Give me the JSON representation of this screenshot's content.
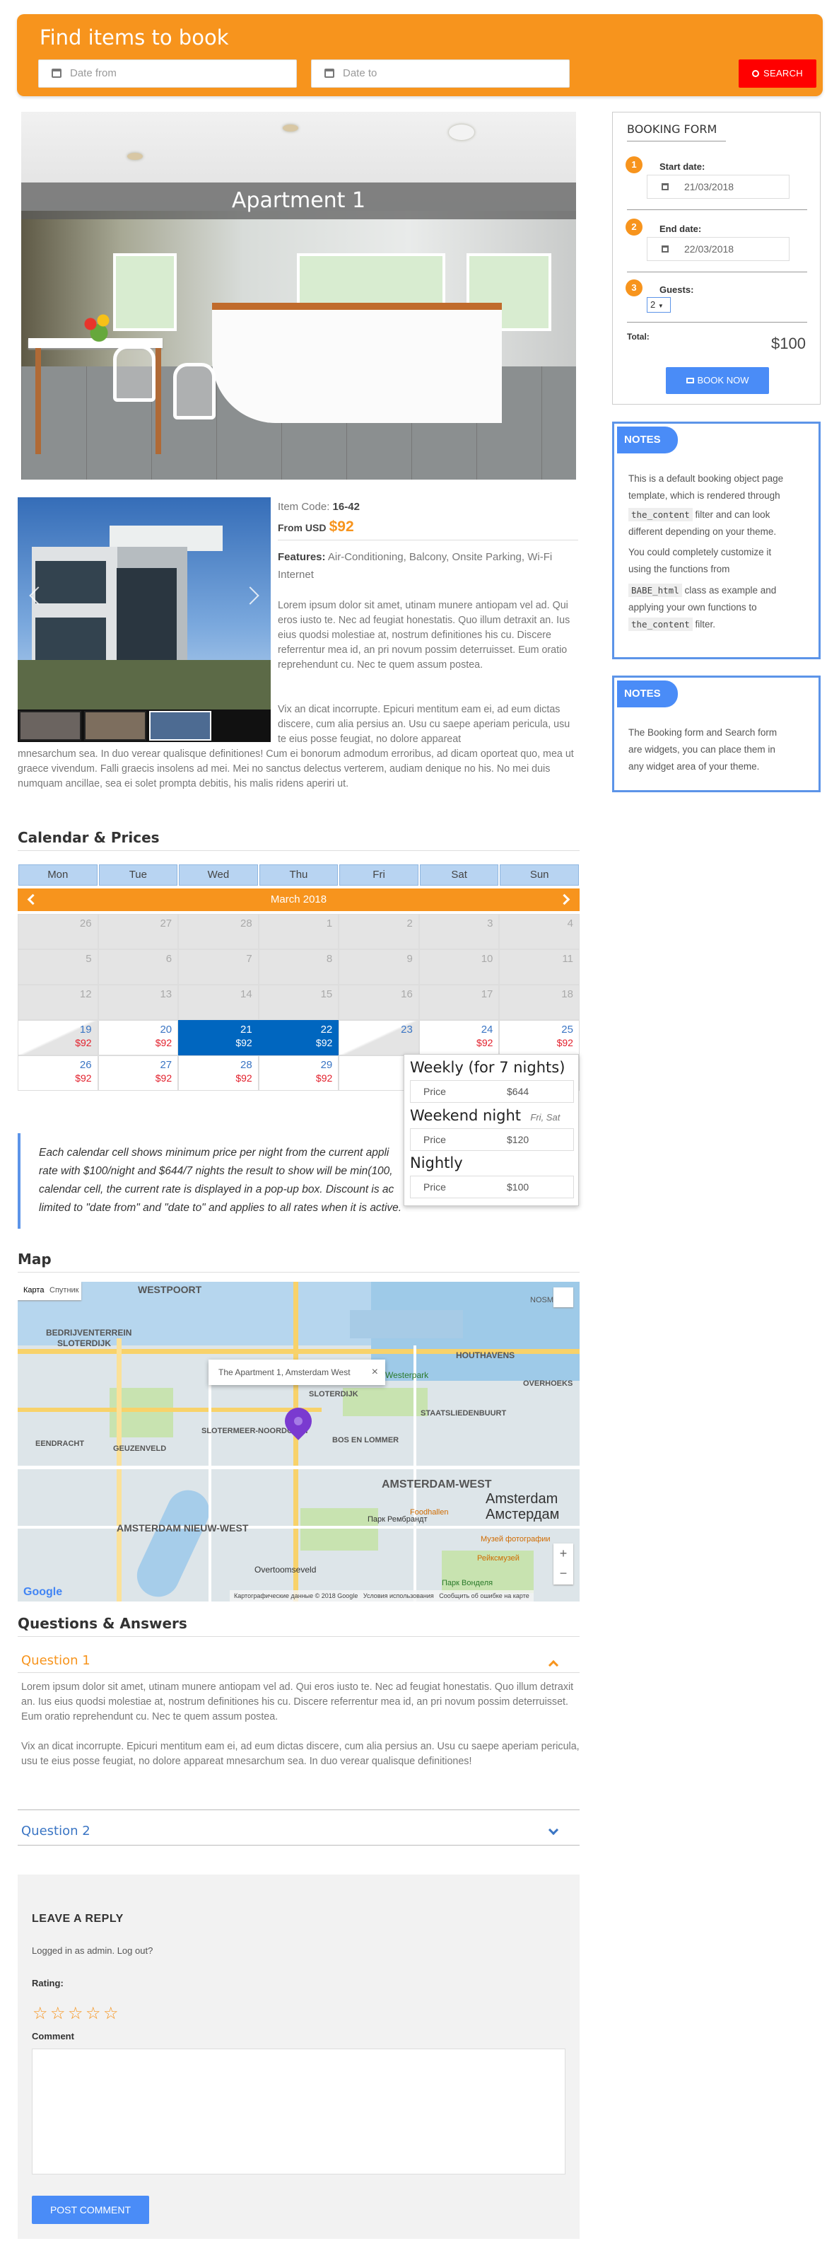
{
  "search": {
    "title": "Find items to book",
    "date_from_placeholder": "Date from",
    "date_to_placeholder": "Date to",
    "search_label": "SEARCH"
  },
  "hero": {
    "title": "Apartment 1"
  },
  "item": {
    "code_label": "Item Code:",
    "code": "16-42",
    "from_label": "From USD",
    "price": "$92",
    "features_label": "Features:",
    "features": "Air-Conditioning, Balcony, Onsite Parking, Wi-Fi Internet",
    "desc_p1": "Lorem ipsum dolor sit amet, utinam munere antiopam vel ad. Qui eros iusto te. Nec ad feugiat honestatis. Quo illum detraxit an. Ius eius quodsi molestiae at, nostrum definitiones his cu. Discere referrentur mea id, an pri novum possim deterruisset. Eum oratio reprehendunt cu. Nec te quem assum postea.",
    "desc_p2_line1": "Vix an dicat incorrupte. Epicuri mentitum eam ei, ad eum dictas discere, cum alia persius an. Usu cu saepe aperiam pericula, usu te eius posse feugiat, no dolore appareat",
    "desc_p2_rest": "mnesarchum sea. In duo verear qualisque definitiones! Cum ei bonorum admodum erroribus, ad dicam oporteat quo, mea ut graece vivendum. Falli graecis insolens ad mei. Mei no sanctus delectus verterem, audiam denique no his. No mei duis numquam ancillae, sea ei solet prompta debitis, his malis ridens aperiri ut."
  },
  "calendar": {
    "section_title": "Calendar & Prices",
    "days": [
      "Mon",
      "Tue",
      "Wed",
      "Thu",
      "Fri",
      "Sat",
      "Sun"
    ],
    "month": "March 2018",
    "weeks": [
      [
        {
          "d": "26",
          "s": "dim"
        },
        {
          "d": "27",
          "s": "dim"
        },
        {
          "d": "28",
          "s": "dim"
        },
        {
          "d": "1",
          "s": "dim"
        },
        {
          "d": "2",
          "s": "dim"
        },
        {
          "d": "3",
          "s": "dim"
        },
        {
          "d": "4",
          "s": "dim"
        }
      ],
      [
        {
          "d": "5",
          "s": "dim"
        },
        {
          "d": "6",
          "s": "dim"
        },
        {
          "d": "7",
          "s": "dim"
        },
        {
          "d": "8",
          "s": "dim"
        },
        {
          "d": "9",
          "s": "dim"
        },
        {
          "d": "10",
          "s": "dim"
        },
        {
          "d": "11",
          "s": "dim"
        }
      ],
      [
        {
          "d": "12",
          "s": "dim"
        },
        {
          "d": "13",
          "s": "dim"
        },
        {
          "d": "14",
          "s": "dim"
        },
        {
          "d": "15",
          "s": "dim"
        },
        {
          "d": "16",
          "s": "dim"
        },
        {
          "d": "17",
          "s": "dim"
        },
        {
          "d": "18",
          "s": "dim"
        }
      ],
      [
        {
          "d": "19",
          "s": "half",
          "p": "$92"
        },
        {
          "d": "20",
          "s": "act",
          "p": "$92"
        },
        {
          "d": "21",
          "s": "sel",
          "p": "$92"
        },
        {
          "d": "22",
          "s": "sel",
          "p": "$92"
        },
        {
          "d": "23",
          "s": "half"
        },
        {
          "d": "24",
          "s": "act",
          "p": "$92"
        },
        {
          "d": "25",
          "s": "act",
          "p": "$92"
        }
      ],
      [
        {
          "d": "26",
          "s": "act",
          "p": "$92"
        },
        {
          "d": "27",
          "s": "act",
          "p": "$92"
        },
        {
          "d": "28",
          "s": "act",
          "p": "$92"
        },
        {
          "d": "29",
          "s": "act",
          "p": "$92"
        },
        {
          "d": "",
          "s": "act"
        },
        {
          "d": "",
          "s": "act"
        },
        {
          "d": "",
          "s": "act"
        }
      ]
    ],
    "popup": {
      "weekly_title": "Weekly (for 7 nights)",
      "weekly_price_label": "Price",
      "weekly_price": "$644",
      "weekend_title": "Weekend night",
      "weekend_days": "Fri, Sat",
      "weekend_price_label": "Price",
      "weekend_price": "$120",
      "nightly_title": "Nightly",
      "nightly_price_label": "Price",
      "nightly_price": "$100"
    }
  },
  "quote": {
    "line1": "Each calendar cell shows minimum price per night from the current appli",
    "line2": "rate with $100/night and $644/7 nights the result to show will be min(100,",
    "line3": "calendar cell, the current rate is displayed in a pop-up box. Discount is ac",
    "line4": "limited to \"date from\" and \"date to\" and applies to all rates when it is active."
  },
  "map": {
    "section_title": "Map",
    "type_map": "Карта",
    "type_sat": "Спутник",
    "infowindow": "The Apartment 1, Amsterdam West",
    "labels": {
      "westpoort": "WESTPOORT",
      "bedrijventerrein": "BEDRIJVENTERREIN",
      "sloterdijk_top": "SLOTERDIJK",
      "houthavens": "HOUTHAVENS",
      "overhoeks": "OVERHOEKS",
      "sloterdijk": "SLOTERDIJK",
      "staatslieden": "STAATSLIEDENBUURT",
      "eendracht": "EENDRACHT",
      "geuzenveld": "GEUZENVELD",
      "slotermeer": "SLOTERMEER-NOORDOOST",
      "bos_en_lommer": "BOS EN LOMMER",
      "amsterdam_west": "AMSTERDAM-WEST",
      "amsterdam": "Amsterdam",
      "amsterdam2": "Амстердам",
      "nieuw_west": "AMSTERDAM NIEUW-WEST",
      "overtoomseveld": "Overtoomseveld",
      "nosm": "NOSM",
      "westerpark": "Westerpark",
      "overtoom": "Overtoom",
      "rembrandt": "Парк Рембрандт",
      "vondel": "Парк Вонделя",
      "foodhallen": "Foodhallen",
      "rijks": "Рейксмузей",
      "nemo": "Музей фотографии"
    },
    "attribution": "Картографические данные © 2018 Google",
    "terms": "Условия использования",
    "report": "Сообщить об ошибке на карте",
    "google": "Google"
  },
  "qa": {
    "section_title": "Questions & Answers",
    "q1": "Question 1",
    "a1_p1": "Lorem ipsum dolor sit amet, utinam munere antiopam vel ad. Qui eros iusto te. Nec ad feugiat honestatis. Quo illum detraxit an. Ius eius quodsi molestiae at, nostrum definitiones his cu. Discere referrentur mea id, an pri novum possim deterruisset. Eum oratio reprehendunt cu. Nec te quem assum postea.",
    "a1_p2": "Vix an dicat incorrupte. Epicuri mentitum eam ei, ad eum dictas discere, cum alia persius an. Usu cu saepe aperiam pericula, usu te eius posse feugiat, no dolore appareat mnesarchum sea. In duo verear qualisque definitiones!",
    "q2": "Question 2"
  },
  "reply": {
    "title": "LEAVE A REPLY",
    "logged": "Logged in as admin. Log out?",
    "rating_label": "Rating:",
    "comment_label": "Comment",
    "submit": "POST COMMENT"
  },
  "booking": {
    "title": "BOOKING FORM",
    "start_label": "Start date:",
    "start_value": "21/03/2018",
    "end_label": "End date:",
    "end_value": "22/03/2018",
    "guests_label": "Guests:",
    "guests_value": "2",
    "total_label": "Total:",
    "total_value": "$100",
    "book_label": "BOOK NOW",
    "step1": "1",
    "step2": "2",
    "step3": "3"
  },
  "notes1": {
    "tag": "NOTES",
    "l1": "This is a default booking object page",
    "l2": "template, which is rendered through",
    "code1": "the_content",
    "l3": " filter and can look",
    "l4": "different depending on your theme.",
    "l5": "You could completely customize it",
    "l6": "using the functions from",
    "code2": "BABE_html",
    "l7": " class as example and",
    "l8": "applying your own functions to",
    "code3": "the_content",
    "l9": " filter."
  },
  "notes2": {
    "tag": "NOTES",
    "l1": "The Booking form and Search form",
    "l2": "are widgets, you can place them in",
    "l3": "any widget area of your theme."
  },
  "colors": {
    "accent": "#f7941d",
    "blue": "#4a8cf7",
    "selected": "#0066bf",
    "price": "#e2202c",
    "search": "#ff0000"
  }
}
